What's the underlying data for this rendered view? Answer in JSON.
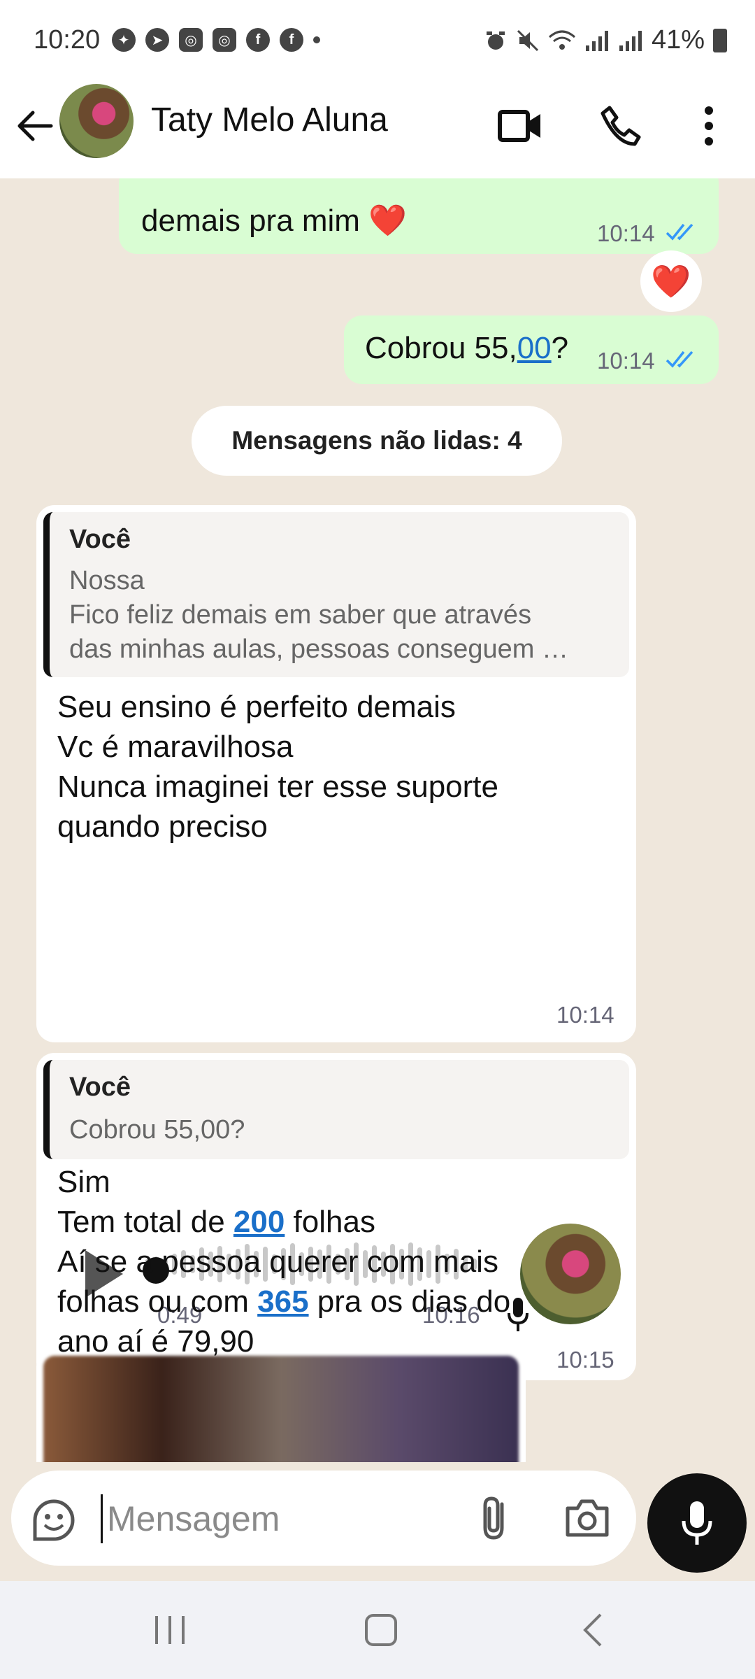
{
  "status_bar": {
    "time": "10:20",
    "battery": "41%",
    "notification_icons": [
      "messenger-icon",
      "telegram-icon",
      "instagram-icon",
      "instagram-icon",
      "facebook-icon",
      "facebook-icon"
    ]
  },
  "header": {
    "contact_name": "Taty Melo Aluna",
    "icons": [
      "back-arrow-icon",
      "video-call-icon",
      "phone-icon",
      "more-options-icon"
    ]
  },
  "messages": {
    "out1": {
      "text": "demais pra mim ❤️",
      "time": "10:14",
      "reaction": "❤️"
    },
    "out2": {
      "text_prefix": "Cobrou 55,",
      "text_link": "00",
      "text_suffix": "?",
      "time": "10:14"
    },
    "unread_label": "Mensagens não lidas: 4",
    "in1": {
      "quote_author": "Você",
      "quote_text": "Nossa\nFico feliz demais em saber que através\ndas minhas aulas, pessoas conseguem …",
      "lines": [
        "Seu ensino é perfeito demais",
        "Vc é maravilhosa",
        "Nunca imaginei ter esse suporte",
        "quando preciso"
      ],
      "time": "10:14"
    },
    "in2": {
      "quote_author": "Você",
      "quote_text": "Cobrou 55,00?",
      "line1": "Sim",
      "line2_prefix": "Tem total de ",
      "line2_link": "200",
      "line2_suffix": " folhas",
      "line3": "Aí se a pessoa querer com mais",
      "line4_prefix": "folhas ou com ",
      "line4_link": "365",
      "line4_suffix": " pra os dias do",
      "line5": "ano aí é 79,90",
      "time": "10:15"
    },
    "voice": {
      "duration": "0:49",
      "time": "10:16"
    }
  },
  "composer": {
    "placeholder": "Mensagem"
  },
  "colors": {
    "outgoing": "#d9fdd3",
    "incoming": "#ffffff",
    "wallpaper": "#efe7dc",
    "link": "#1a6fc9",
    "read_ticks": "#3497f9"
  }
}
